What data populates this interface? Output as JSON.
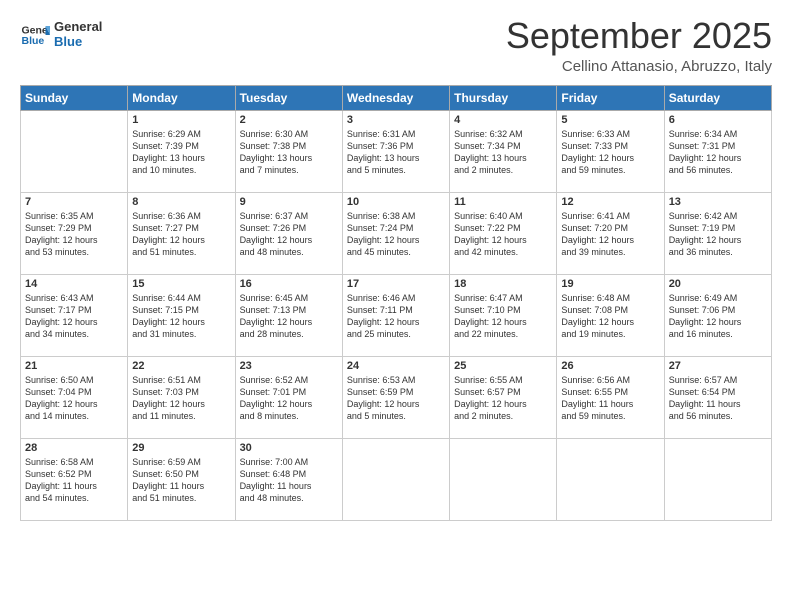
{
  "header": {
    "logo_general": "General",
    "logo_blue": "Blue",
    "month": "September 2025",
    "location": "Cellino Attanasio, Abruzzo, Italy"
  },
  "days_of_week": [
    "Sunday",
    "Monday",
    "Tuesday",
    "Wednesday",
    "Thursday",
    "Friday",
    "Saturday"
  ],
  "weeks": [
    [
      {
        "day": "",
        "content": ""
      },
      {
        "day": "1",
        "content": "Sunrise: 6:29 AM\nSunset: 7:39 PM\nDaylight: 13 hours\nand 10 minutes."
      },
      {
        "day": "2",
        "content": "Sunrise: 6:30 AM\nSunset: 7:38 PM\nDaylight: 13 hours\nand 7 minutes."
      },
      {
        "day": "3",
        "content": "Sunrise: 6:31 AM\nSunset: 7:36 PM\nDaylight: 13 hours\nand 5 minutes."
      },
      {
        "day": "4",
        "content": "Sunrise: 6:32 AM\nSunset: 7:34 PM\nDaylight: 13 hours\nand 2 minutes."
      },
      {
        "day": "5",
        "content": "Sunrise: 6:33 AM\nSunset: 7:33 PM\nDaylight: 12 hours\nand 59 minutes."
      },
      {
        "day": "6",
        "content": "Sunrise: 6:34 AM\nSunset: 7:31 PM\nDaylight: 12 hours\nand 56 minutes."
      }
    ],
    [
      {
        "day": "7",
        "content": "Sunrise: 6:35 AM\nSunset: 7:29 PM\nDaylight: 12 hours\nand 53 minutes."
      },
      {
        "day": "8",
        "content": "Sunrise: 6:36 AM\nSunset: 7:27 PM\nDaylight: 12 hours\nand 51 minutes."
      },
      {
        "day": "9",
        "content": "Sunrise: 6:37 AM\nSunset: 7:26 PM\nDaylight: 12 hours\nand 48 minutes."
      },
      {
        "day": "10",
        "content": "Sunrise: 6:38 AM\nSunset: 7:24 PM\nDaylight: 12 hours\nand 45 minutes."
      },
      {
        "day": "11",
        "content": "Sunrise: 6:40 AM\nSunset: 7:22 PM\nDaylight: 12 hours\nand 42 minutes."
      },
      {
        "day": "12",
        "content": "Sunrise: 6:41 AM\nSunset: 7:20 PM\nDaylight: 12 hours\nand 39 minutes."
      },
      {
        "day": "13",
        "content": "Sunrise: 6:42 AM\nSunset: 7:19 PM\nDaylight: 12 hours\nand 36 minutes."
      }
    ],
    [
      {
        "day": "14",
        "content": "Sunrise: 6:43 AM\nSunset: 7:17 PM\nDaylight: 12 hours\nand 34 minutes."
      },
      {
        "day": "15",
        "content": "Sunrise: 6:44 AM\nSunset: 7:15 PM\nDaylight: 12 hours\nand 31 minutes."
      },
      {
        "day": "16",
        "content": "Sunrise: 6:45 AM\nSunset: 7:13 PM\nDaylight: 12 hours\nand 28 minutes."
      },
      {
        "day": "17",
        "content": "Sunrise: 6:46 AM\nSunset: 7:11 PM\nDaylight: 12 hours\nand 25 minutes."
      },
      {
        "day": "18",
        "content": "Sunrise: 6:47 AM\nSunset: 7:10 PM\nDaylight: 12 hours\nand 22 minutes."
      },
      {
        "day": "19",
        "content": "Sunrise: 6:48 AM\nSunset: 7:08 PM\nDaylight: 12 hours\nand 19 minutes."
      },
      {
        "day": "20",
        "content": "Sunrise: 6:49 AM\nSunset: 7:06 PM\nDaylight: 12 hours\nand 16 minutes."
      }
    ],
    [
      {
        "day": "21",
        "content": "Sunrise: 6:50 AM\nSunset: 7:04 PM\nDaylight: 12 hours\nand 14 minutes."
      },
      {
        "day": "22",
        "content": "Sunrise: 6:51 AM\nSunset: 7:03 PM\nDaylight: 12 hours\nand 11 minutes."
      },
      {
        "day": "23",
        "content": "Sunrise: 6:52 AM\nSunset: 7:01 PM\nDaylight: 12 hours\nand 8 minutes."
      },
      {
        "day": "24",
        "content": "Sunrise: 6:53 AM\nSunset: 6:59 PM\nDaylight: 12 hours\nand 5 minutes."
      },
      {
        "day": "25",
        "content": "Sunrise: 6:55 AM\nSunset: 6:57 PM\nDaylight: 12 hours\nand 2 minutes."
      },
      {
        "day": "26",
        "content": "Sunrise: 6:56 AM\nSunset: 6:55 PM\nDaylight: 11 hours\nand 59 minutes."
      },
      {
        "day": "27",
        "content": "Sunrise: 6:57 AM\nSunset: 6:54 PM\nDaylight: 11 hours\nand 56 minutes."
      }
    ],
    [
      {
        "day": "28",
        "content": "Sunrise: 6:58 AM\nSunset: 6:52 PM\nDaylight: 11 hours\nand 54 minutes."
      },
      {
        "day": "29",
        "content": "Sunrise: 6:59 AM\nSunset: 6:50 PM\nDaylight: 11 hours\nand 51 minutes."
      },
      {
        "day": "30",
        "content": "Sunrise: 7:00 AM\nSunset: 6:48 PM\nDaylight: 11 hours\nand 48 minutes."
      },
      {
        "day": "",
        "content": ""
      },
      {
        "day": "",
        "content": ""
      },
      {
        "day": "",
        "content": ""
      },
      {
        "day": "",
        "content": ""
      }
    ]
  ]
}
